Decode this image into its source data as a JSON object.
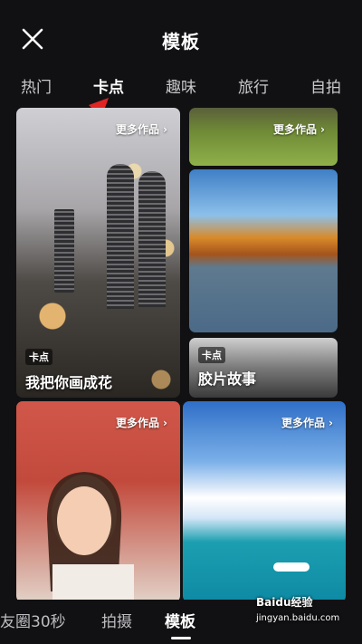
{
  "header": {
    "title": "模板"
  },
  "tabs": [
    {
      "label": "热门"
    },
    {
      "label": "卡点",
      "active": true
    },
    {
      "label": "趣味"
    },
    {
      "label": "旅行"
    },
    {
      "label": "自拍"
    }
  ],
  "cards": [
    {
      "more_label": "更多作品",
      "badge": "卡点",
      "title": "我把你画成花"
    },
    {
      "more_label": "更多作品"
    },
    {
      "badge": "卡点",
      "title": "胶片故事"
    },
    {
      "more_label": "更多作品"
    },
    {
      "more_label": "更多作品"
    }
  ],
  "bottom_nav": [
    {
      "label": "友圈30秒"
    },
    {
      "label": "拍摄"
    },
    {
      "label": "模板",
      "active": true
    }
  ],
  "watermark": {
    "brand": "Baidu经验",
    "url": "jingyan.baidu.com"
  },
  "colors": {
    "background": "#111113",
    "accent_arrow": "#e02424",
    "active_text": "#ffffff",
    "inactive_text": "#c9c9cc"
  }
}
